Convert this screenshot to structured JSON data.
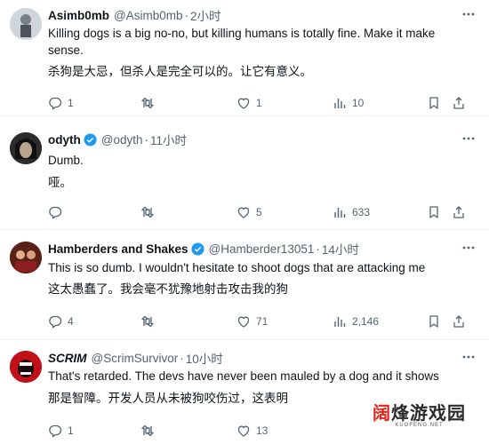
{
  "tweets": [
    {
      "name": "Asimb0mb",
      "handle": "@Asimb0mb",
      "time": "2小时",
      "verified": false,
      "text_en": "Killing dogs is a big no-no, but killing humans is totally fine. Make it make sense.",
      "text_zh": "杀狗是大忌，但杀人是完全可以的。让它有意义。",
      "replies": "1",
      "retweets": "",
      "likes": "1",
      "views": "10"
    },
    {
      "name": "odyth",
      "handle": "@odyth",
      "time": "11小时",
      "verified": true,
      "text_en": "Dumb.",
      "text_zh": "哑。",
      "replies": "",
      "retweets": "",
      "likes": "5",
      "views": "633"
    },
    {
      "name": "Hamberders and Shakes",
      "handle": "@Hamberder13051",
      "time": "14小时",
      "verified": true,
      "text_en": "This is so dumb. I wouldn't hesitate to shoot dogs that are attacking me",
      "text_zh": "这太愚蠢了。我会毫不犹豫地射击攻击我的狗",
      "replies": "4",
      "retweets": "",
      "likes": "71",
      "views": "2,146"
    },
    {
      "name": "SCRIM",
      "handle": "@ScrimSurvivor",
      "time": "10小时",
      "verified": false,
      "text_en": "That's retarded. The devs have never been mauled by a dog and it shows",
      "text_zh": "那是智障。开发人员从未被狗咬伤过，这表明",
      "replies": "1",
      "retweets": "",
      "likes": "13",
      "views": ""
    }
  ],
  "separator": "·",
  "watermark": {
    "title_a": "阔",
    "title_b": "烽游戏园",
    "subtitle": "KUOFENG.NET"
  },
  "colors": {
    "verified": "#1d9bf0",
    "muted": "#536471",
    "text": "#0f1419",
    "divider": "#eff3f4"
  }
}
